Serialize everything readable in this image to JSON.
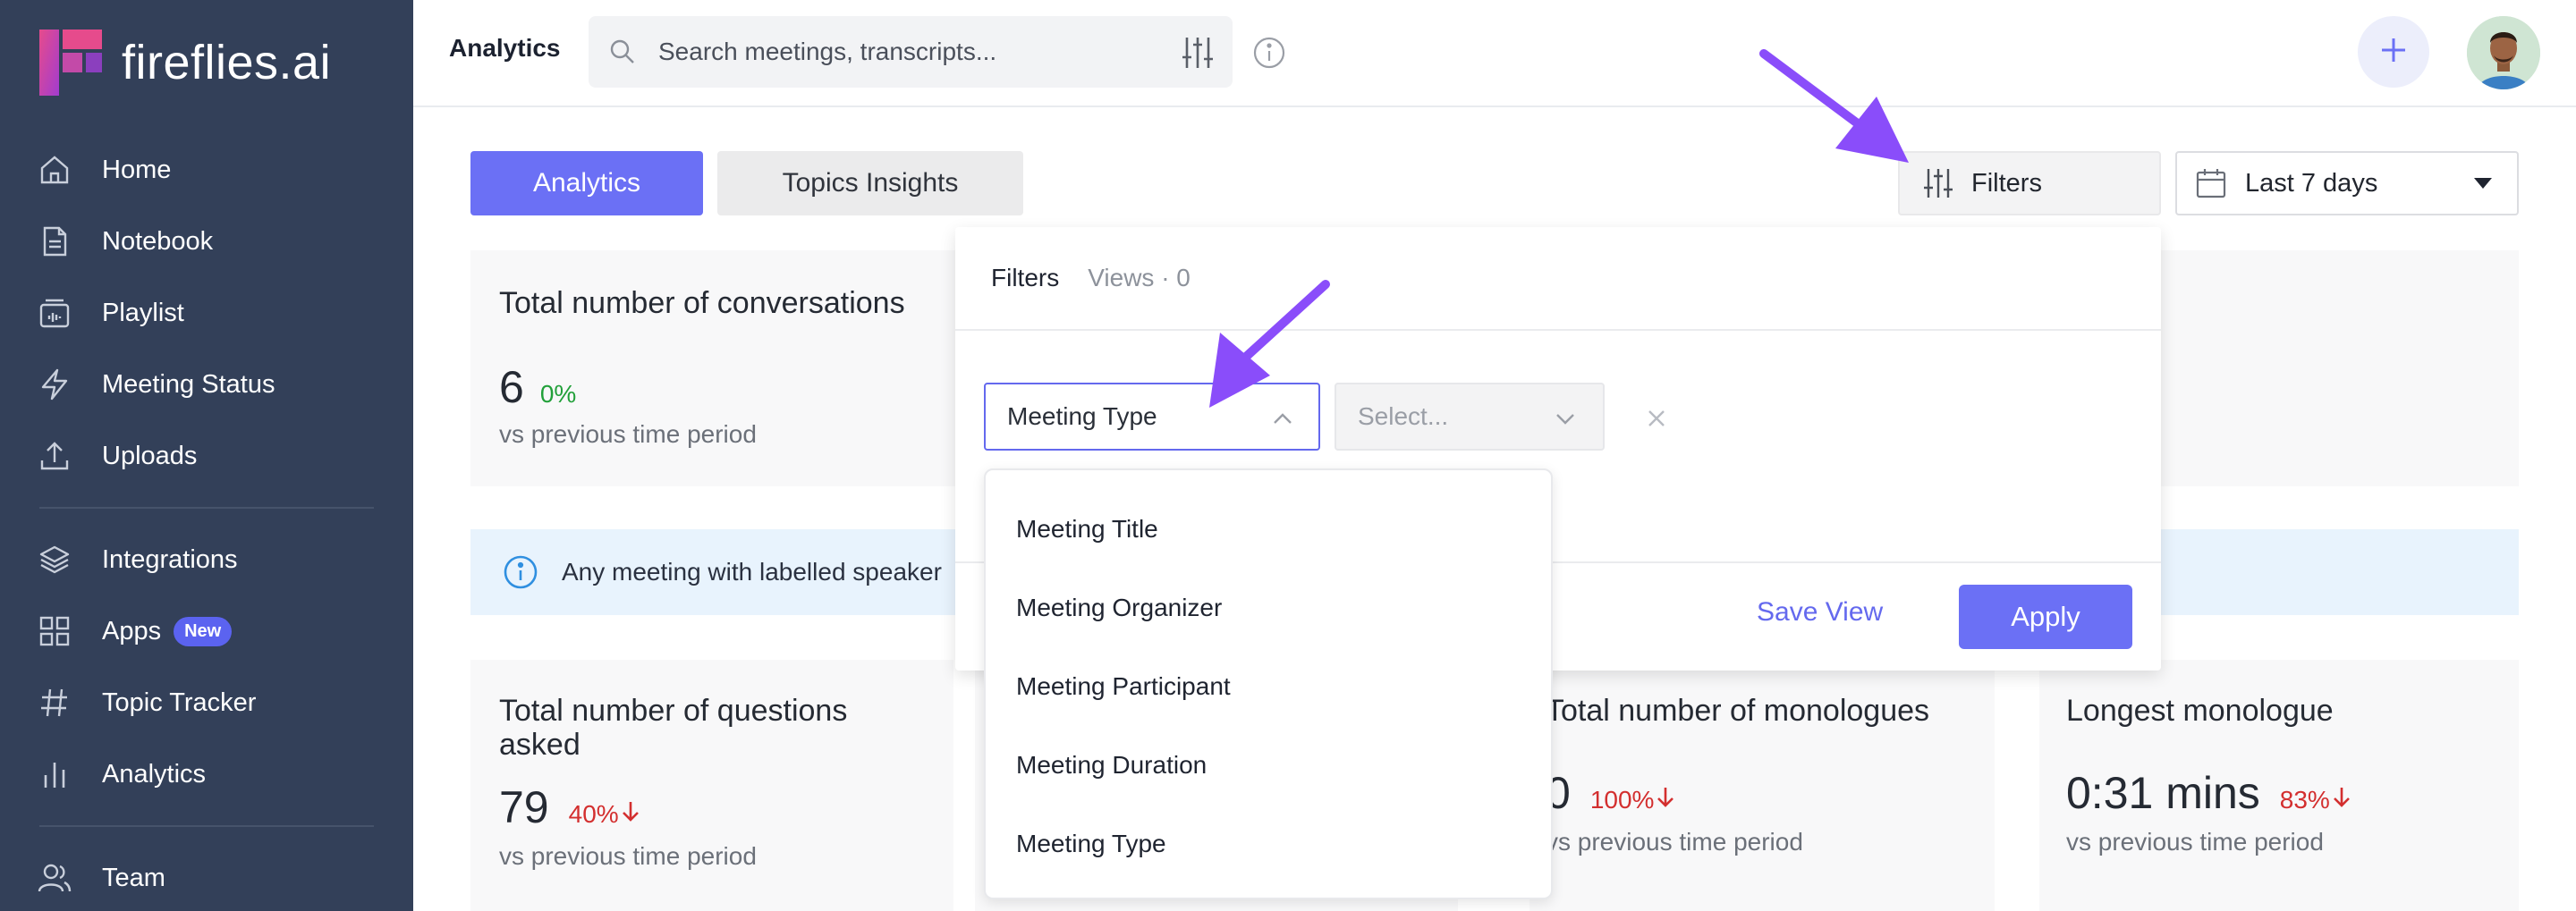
{
  "brand": {
    "name": "fireflies.ai"
  },
  "sidebar": {
    "items": [
      {
        "label": "Home",
        "icon": "home-icon"
      },
      {
        "label": "Notebook",
        "icon": "notebook-icon"
      },
      {
        "label": "Playlist",
        "icon": "playlist-icon"
      },
      {
        "label": "Meeting Status",
        "icon": "lightning-icon"
      },
      {
        "label": "Uploads",
        "icon": "upload-icon"
      },
      {
        "label": "Integrations",
        "icon": "layers-icon"
      },
      {
        "label": "Apps",
        "icon": "grid-icon",
        "badge": "New"
      },
      {
        "label": "Topic Tracker",
        "icon": "hash-icon"
      },
      {
        "label": "Analytics",
        "icon": "bar-chart-icon"
      },
      {
        "label": "Team",
        "icon": "team-icon"
      }
    ]
  },
  "topbar": {
    "title": "Analytics",
    "search_placeholder": "Search meetings, transcripts..."
  },
  "tabs": {
    "analytics": "Analytics",
    "topics": "Topics Insights"
  },
  "controls": {
    "filters_label": "Filters",
    "date_range": "Last 7 days"
  },
  "cards": {
    "conversations": {
      "title": "Total number of conversations",
      "value": "6",
      "change": "0%",
      "sub": "vs previous time period"
    },
    "questions": {
      "title": "Total number of questions asked",
      "value": "79",
      "change": "40%",
      "sub": "vs previous time period"
    },
    "monologues": {
      "title": "Total number of monologues",
      "value": "0",
      "change": "100%",
      "sub": "vs previous time period"
    },
    "longest": {
      "title": "Longest monologue",
      "value": "0:31 mins",
      "change": "83%",
      "sub": "vs previous time period"
    }
  },
  "banner": {
    "text": "Any meeting with labelled speaker"
  },
  "filters_panel": {
    "title": "Filters",
    "views": "Views · 0",
    "field_selected": "Meeting Type",
    "value_placeholder": "Select...",
    "save_view": "Save View",
    "apply": "Apply"
  },
  "dropdown_options": [
    "Meeting Title",
    "Meeting Organizer",
    "Meeting Participant",
    "Meeting Duration",
    "Meeting Type"
  ],
  "colors": {
    "sidebar": "#334059",
    "accent": "#6b70f5",
    "annotation": "#8a4dfa",
    "positive": "#22a03a",
    "negative": "#d32f2f"
  }
}
